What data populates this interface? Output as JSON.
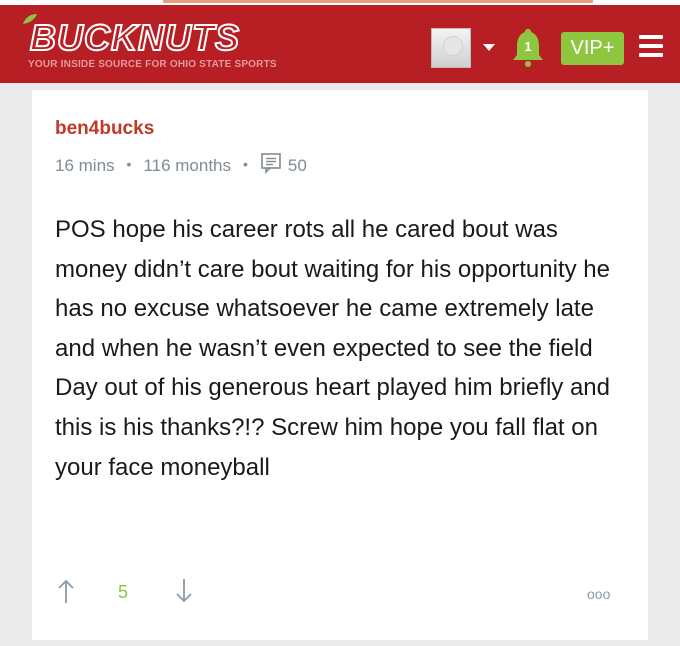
{
  "header": {
    "logo_text": "BUCKNUTS",
    "tagline": "YOUR INSIDE SOURCE FOR OHIO STATE SPORTS",
    "notification_count": "1",
    "vip_label": "VIP+",
    "brand_color": "#b81f24",
    "accent_color": "#8ec641",
    "icons": [
      "avatar",
      "chevron-down-icon",
      "bell-icon",
      "hamburger-menu-icon"
    ]
  },
  "comment": {
    "username": "ben4bucks",
    "posted_ago": "16 mins",
    "member_for": "116 months",
    "reply_count": "50",
    "body": "POS hope his career rots all he cared bout was money didn’t care bout waiting for his opportunity he has no excuse whatsoever he came extremely late and when he wasn’t even expected to see the field Day out of his generous heart played him briefly and this is his thanks?!? Screw him hope you fall flat on your face moneyball",
    "vote_score": "5",
    "more_label": "ooo",
    "icons": [
      "comment-icon",
      "upvote-arrow-icon",
      "downvote-arrow-icon",
      "more-icon"
    ]
  }
}
